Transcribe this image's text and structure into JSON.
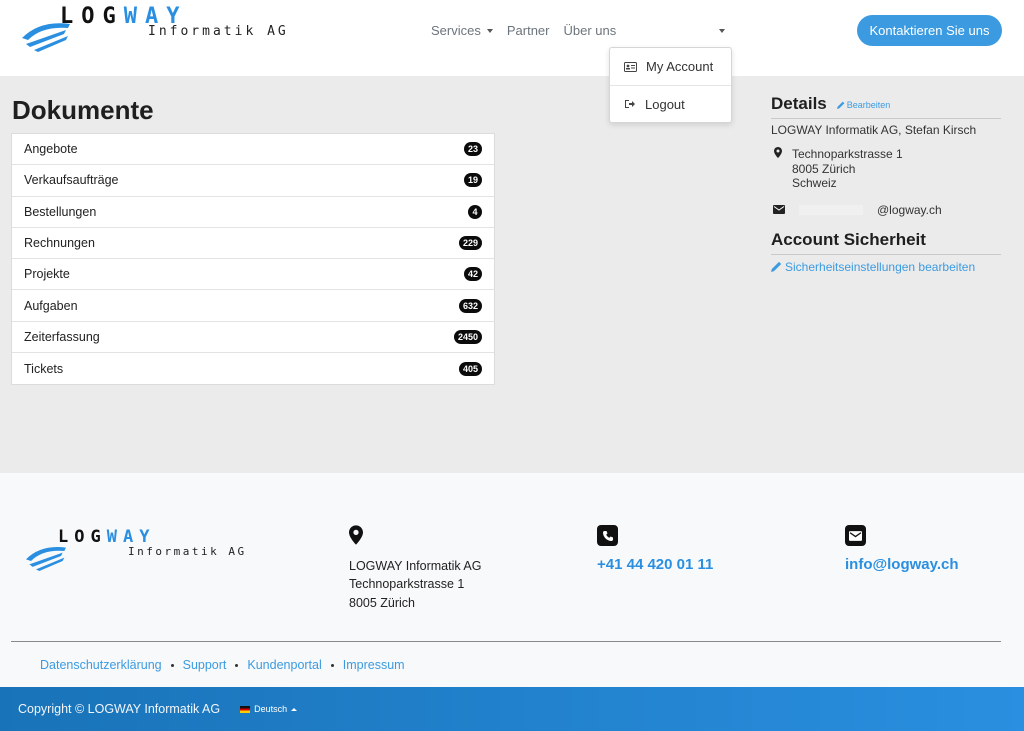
{
  "header": {
    "logo": {
      "word_main": "LOG",
      "word_accent": "WAY",
      "sub": "Informatik AG"
    },
    "nav": [
      {
        "label": "Services",
        "has_caret": true
      },
      {
        "label": "Partner",
        "has_caret": false
      },
      {
        "label": "Über uns",
        "has_caret": false
      }
    ],
    "cta_label": "Kontaktieren Sie uns",
    "user_menu": [
      {
        "label": "My Account",
        "icon": "id-card-icon"
      },
      {
        "label": "Logout",
        "icon": "logout-icon"
      }
    ]
  },
  "main": {
    "title": "Dokumente",
    "documents": [
      {
        "label": "Angebote",
        "count": "23"
      },
      {
        "label": "Verkaufsaufträge",
        "count": "19"
      },
      {
        "label": "Bestellungen",
        "count": "4"
      },
      {
        "label": "Rechnungen",
        "count": "229"
      },
      {
        "label": "Projekte",
        "count": "42"
      },
      {
        "label": "Aufgaben",
        "count": "632"
      },
      {
        "label": "Zeiterfassung",
        "count": "2450"
      },
      {
        "label": "Tickets",
        "count": "405"
      }
    ],
    "details": {
      "title": "Details",
      "edit_label": "Bearbeiten",
      "company": "LOGWAY Informatik AG, Stefan Kirsch",
      "address": [
        "Technoparkstrasse 1",
        "8005 Zürich",
        "Schweiz"
      ],
      "email_domain": "@logway.ch"
    },
    "security": {
      "title": "Account Sicherheit",
      "link_label": "Sicherheitseinstellungen bearbeiten"
    }
  },
  "footer": {
    "logo": {
      "word_main": "LOG",
      "word_accent": "WAY",
      "sub": "Informatik AG"
    },
    "address": [
      "LOGWAY Informatik AG",
      "Technoparkstrasse 1",
      "8005 Zürich"
    ],
    "phone": "+41 44 420 01 11",
    "email": "info@logway.ch",
    "links": [
      "Datenschutzerklärung",
      "Support",
      "Kundenportal",
      "Impressum"
    ],
    "copyright": "Copyright © LOGWAY Informatik AG",
    "language": "Deutsch"
  },
  "colors": {
    "accent": "#3c9be0",
    "brand_blue": "#2a8fe0",
    "badge": "#0b0b0b"
  }
}
